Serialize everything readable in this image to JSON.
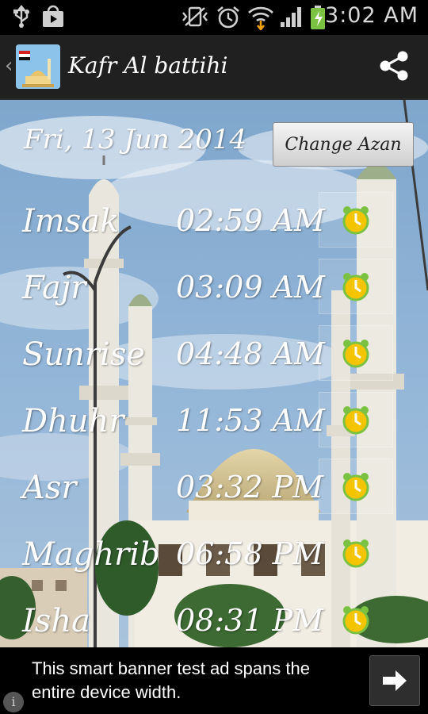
{
  "status_bar": {
    "time": "3:02 AM",
    "icons": [
      "usb-icon",
      "store-icon",
      "vibrate-icon",
      "alarm-icon",
      "wifi-icon",
      "signal-icon",
      "battery-icon"
    ]
  },
  "action_bar": {
    "title": "Kafr Al battihi",
    "back_icon": "back-chevron-icon",
    "share_icon": "share-icon"
  },
  "main": {
    "date": "Fri, 13 Jun 2014",
    "change_azan_label": "Change Azan",
    "prayers": [
      {
        "name": "Imsak",
        "time": "02:59 AM"
      },
      {
        "name": "Fajr",
        "time": "03:09 AM"
      },
      {
        "name": "Sunrise",
        "time": "04:48 AM"
      },
      {
        "name": "Dhuhr",
        "time": "11:53 AM"
      },
      {
        "name": "Asr",
        "time": "03:32 PM"
      },
      {
        "name": "Maghrib",
        "time": "06:58 PM"
      },
      {
        "name": "Isha",
        "time": "08:31 PM"
      }
    ]
  },
  "ad": {
    "text": "This smart banner test ad spans the entire device width.",
    "info_label": "i"
  },
  "colors": {
    "action_bar": "#202020",
    "alarm_yellow": "#f5c400",
    "alarm_green": "#7cc242"
  }
}
